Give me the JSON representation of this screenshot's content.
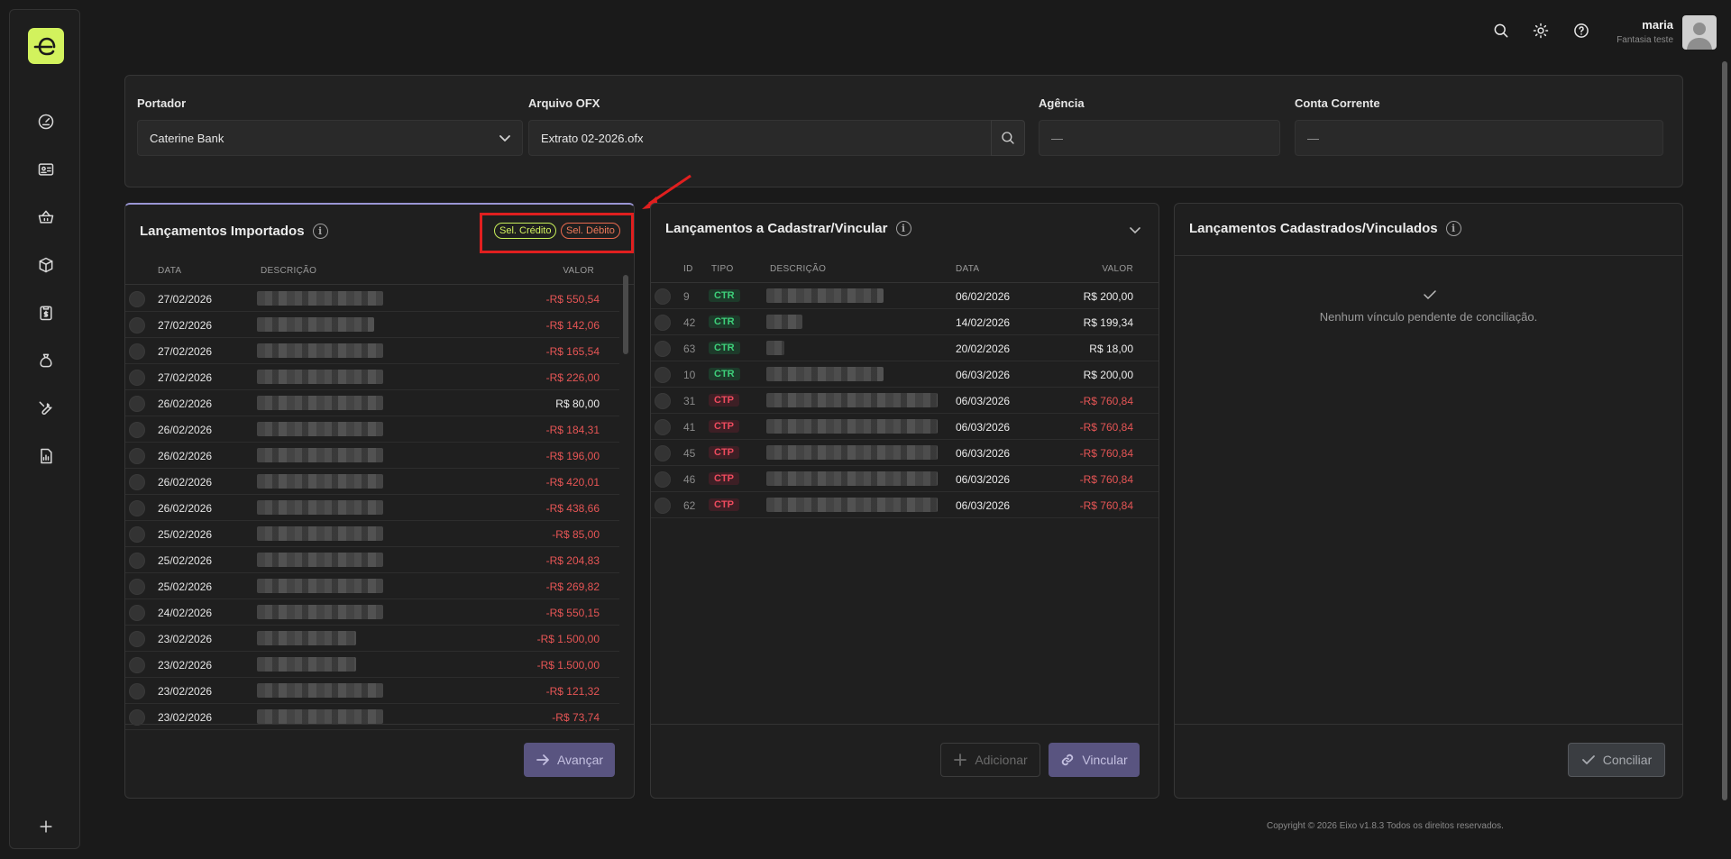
{
  "user": {
    "name": "maria",
    "company": "Fantasia teste"
  },
  "filters": {
    "portador_label": "Portador",
    "portador_value": "Caterine Bank",
    "arquivo_label": "Arquivo OFX",
    "arquivo_value": "Extrato 02-2026.ofx",
    "agencia_label": "Agência",
    "agencia_value": "—",
    "conta_label": "Conta Corrente",
    "conta_value": "—"
  },
  "imported": {
    "title": "Lançamentos Importados",
    "chip_credit": "Sel. Crédito",
    "chip_debit": "Sel. Débito",
    "headers": {
      "date": "DATA",
      "desc": "DESCRIÇÃO",
      "value": "VALOR"
    },
    "rows": [
      {
        "date": "27/02/2026",
        "value": "-R$ 550,54",
        "neg": true,
        "w": 140
      },
      {
        "date": "27/02/2026",
        "value": "-R$ 142,06",
        "neg": true,
        "w": 130
      },
      {
        "date": "27/02/2026",
        "value": "-R$ 165,54",
        "neg": true,
        "w": 140
      },
      {
        "date": "27/02/2026",
        "value": "-R$ 226,00",
        "neg": true,
        "w": 140
      },
      {
        "date": "26/02/2026",
        "value": "R$ 80,00",
        "neg": false,
        "w": 140
      },
      {
        "date": "26/02/2026",
        "value": "-R$ 184,31",
        "neg": true,
        "w": 140
      },
      {
        "date": "26/02/2026",
        "value": "-R$ 196,00",
        "neg": true,
        "w": 140
      },
      {
        "date": "26/02/2026",
        "value": "-R$ 420,01",
        "neg": true,
        "w": 140
      },
      {
        "date": "26/02/2026",
        "value": "-R$ 438,66",
        "neg": true,
        "w": 140
      },
      {
        "date": "25/02/2026",
        "value": "-R$ 85,00",
        "neg": true,
        "w": 140
      },
      {
        "date": "25/02/2026",
        "value": "-R$ 204,83",
        "neg": true,
        "w": 140
      },
      {
        "date": "25/02/2026",
        "value": "-R$ 269,82",
        "neg": true,
        "w": 140
      },
      {
        "date": "24/02/2026",
        "value": "-R$ 550,15",
        "neg": true,
        "w": 140
      },
      {
        "date": "23/02/2026",
        "value": "-R$ 1.500,00",
        "neg": true,
        "w": 110
      },
      {
        "date": "23/02/2026",
        "value": "-R$ 1.500,00",
        "neg": true,
        "w": 110
      },
      {
        "date": "23/02/2026",
        "value": "-R$ 121,32",
        "neg": true,
        "w": 140
      },
      {
        "date": "23/02/2026",
        "value": "-R$ 73,74",
        "neg": true,
        "w": 140
      }
    ],
    "advance_label": "Avançar"
  },
  "to_register": {
    "title": "Lançamentos a Cadastrar/Vincular",
    "headers": {
      "id": "ID",
      "type": "TIPO",
      "desc": "DESCRIÇÃO",
      "date": "DATA",
      "value": "VALOR"
    },
    "rows": [
      {
        "id": "9",
        "type": "CTR",
        "date": "06/02/2026",
        "value": "R$ 200,00",
        "neg": false,
        "w": 130
      },
      {
        "id": "42",
        "type": "CTR",
        "date": "14/02/2026",
        "value": "R$ 199,34",
        "neg": false,
        "w": 40
      },
      {
        "id": "63",
        "type": "CTR",
        "date": "20/02/2026",
        "value": "R$ 18,00",
        "neg": false,
        "w": 20
      },
      {
        "id": "10",
        "type": "CTR",
        "date": "06/03/2026",
        "value": "R$ 200,00",
        "neg": false,
        "w": 130
      },
      {
        "id": "31",
        "type": "CTP",
        "date": "06/03/2026",
        "value": "-R$ 760,84",
        "neg": true,
        "w": 190
      },
      {
        "id": "41",
        "type": "CTP",
        "date": "06/03/2026",
        "value": "-R$ 760,84",
        "neg": true,
        "w": 190
      },
      {
        "id": "45",
        "type": "CTP",
        "date": "06/03/2026",
        "value": "-R$ 760,84",
        "neg": true,
        "w": 190
      },
      {
        "id": "46",
        "type": "CTP",
        "date": "06/03/2026",
        "value": "-R$ 760,84",
        "neg": true,
        "w": 190
      },
      {
        "id": "62",
        "type": "CTP",
        "date": "06/03/2026",
        "value": "-R$ 760,84",
        "neg": true,
        "w": 190
      }
    ],
    "add_label": "Adicionar",
    "link_label": "Vincular"
  },
  "registered": {
    "title": "Lançamentos Cadastrados/Vinculados",
    "empty_message": "Nenhum vínculo pendente de conciliação.",
    "reconcile_label": "Conciliar"
  },
  "footer": "Copyright © 2026 Eixo v1.8.3 Todos os direitos reservados."
}
